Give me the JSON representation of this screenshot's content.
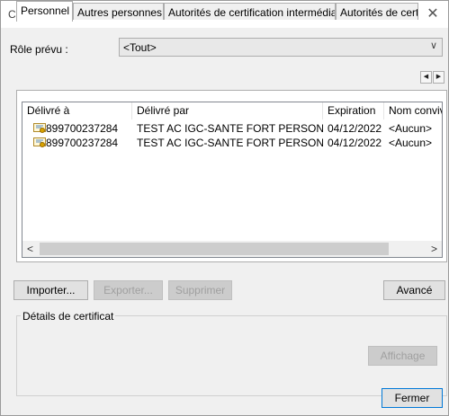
{
  "window": {
    "title": "Certificats",
    "close_glyph": "✕"
  },
  "role": {
    "label": "Rôle prévu :",
    "value": "<Tout>"
  },
  "tabs": [
    {
      "label": "Personnel"
    },
    {
      "label": "Autres personnes"
    },
    {
      "label": "Autorités de certification intermédiaires"
    },
    {
      "label": "Autorités de certi"
    }
  ],
  "table": {
    "columns": [
      "Délivré à",
      "Délivré par",
      "Expiration",
      "Nom conviv"
    ],
    "rows": [
      {
        "issued_to": "899700237284",
        "issued_by": "TEST AC IGC-SANTE FORT PERSONNES",
        "expiration": "04/12/2022",
        "friendly_name": "<Aucun>"
      },
      {
        "issued_to": "899700237284",
        "issued_by": "TEST AC IGC-SANTE FORT PERSONNES",
        "expiration": "04/12/2022",
        "friendly_name": "<Aucun>"
      }
    ]
  },
  "buttons": {
    "import": "Importer...",
    "export": "Exporter...",
    "delete": "Supprimer",
    "advanced": "Avancé",
    "view": "Affichage",
    "close": "Fermer"
  },
  "details": {
    "label": "Détails de certificat"
  },
  "icons": {
    "close": "close-icon",
    "dropdown": "chevron-down-icon",
    "cert": "certificate-icon",
    "scroll_left": "chevron-left-icon",
    "scroll_right": "chevron-right-icon"
  }
}
